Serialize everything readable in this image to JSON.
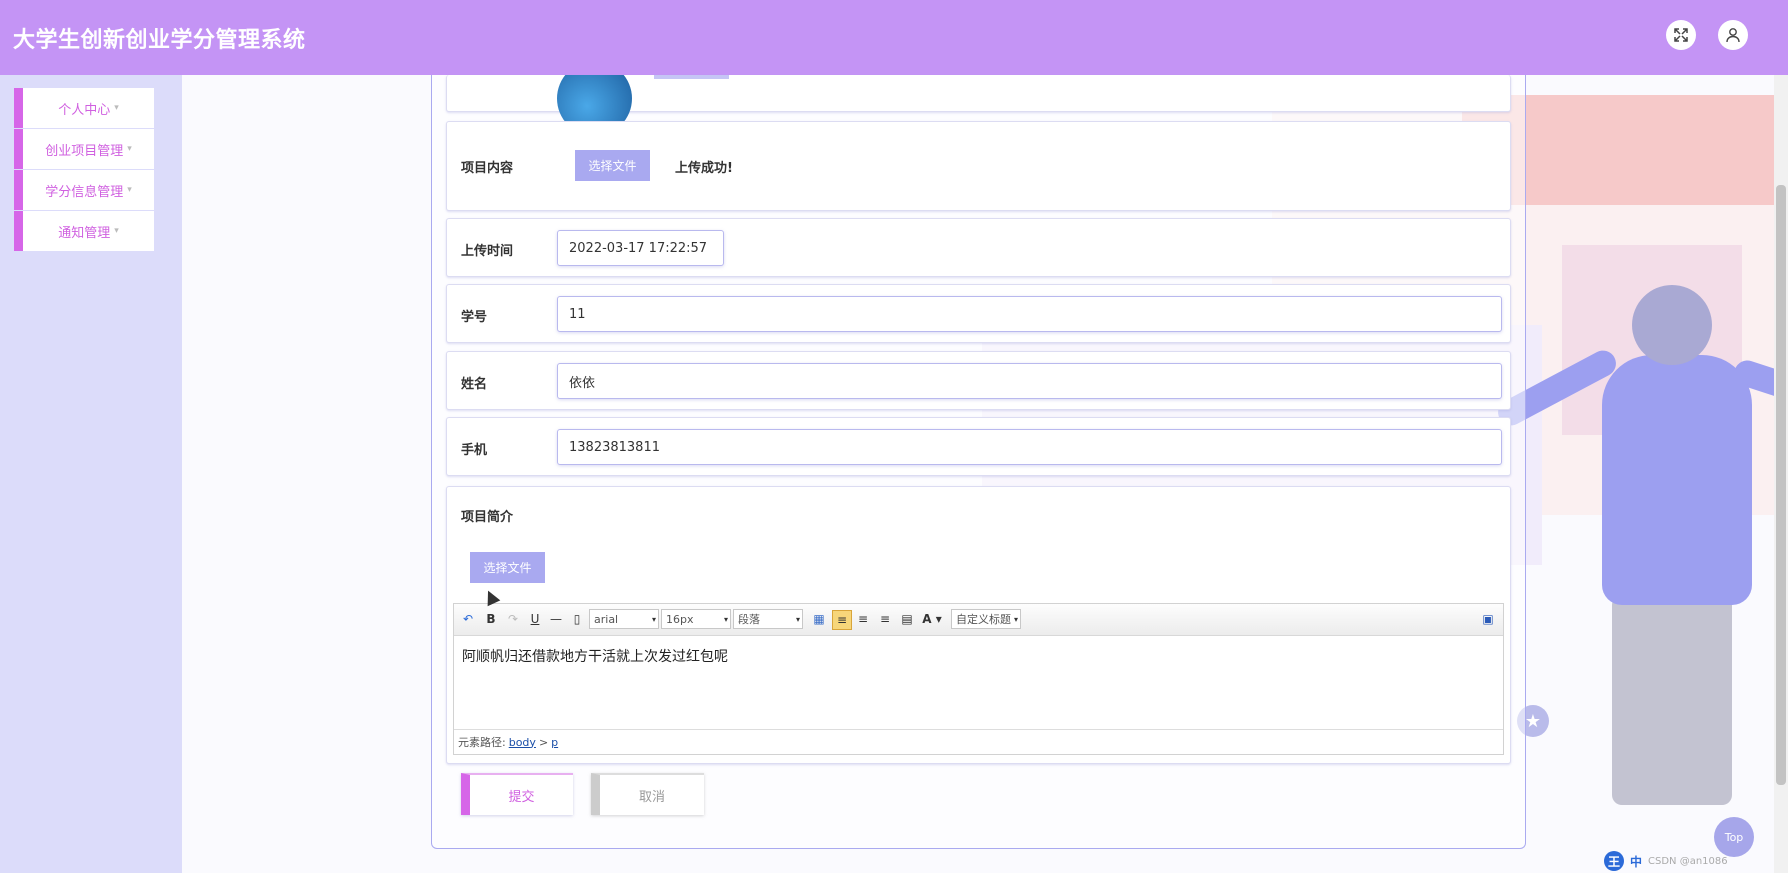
{
  "header": {
    "title": "大学生创新创业学分管理系统",
    "fullscreen_icon": "expand-icon",
    "user_icon": "user-icon"
  },
  "sidebar": {
    "items": [
      {
        "label": "个人中心"
      },
      {
        "label": "创业项目管理"
      },
      {
        "label": "学分信息管理"
      },
      {
        "label": "通知管理"
      }
    ],
    "caret": "▾"
  },
  "form": {
    "project_content": {
      "label": "项目内容",
      "button": "选择文件",
      "status": "上传成功!"
    },
    "upload_time": {
      "label": "上传时间",
      "value": "2022-03-17 17:22:57"
    },
    "student_id": {
      "label": "学号",
      "value": "11"
    },
    "name": {
      "label": "姓名",
      "value": "依依"
    },
    "phone": {
      "label": "手机",
      "value": "13823813811"
    },
    "intro": {
      "label": "项目简介",
      "button": "选择文件",
      "editor": {
        "font": "arial",
        "size": "16px",
        "paragraph": "段落",
        "custom_title": "自定义标题",
        "font_color_glyph": "A",
        "content": "阿顺帆归还借款地方干活就上次发过红包呢",
        "path_label": "元素路径:",
        "path_body": "body",
        "path_sep": ">",
        "path_p": "p"
      }
    },
    "submit": "提交",
    "cancel": "取消"
  },
  "top_button": "Top",
  "ime": {
    "badge": "王",
    "lang": "中",
    "watermark": "CSDN @an1086"
  }
}
